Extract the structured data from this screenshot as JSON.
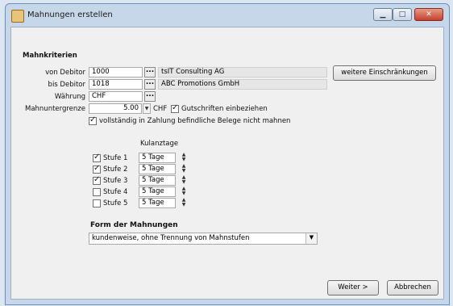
{
  "window": {
    "title": "Mahnungen erstellen"
  },
  "section_title": "Mahnkriterien",
  "fields": {
    "von_debitor": {
      "label": "von Debitor",
      "value": "1000",
      "name": "tsIT Consulting AG"
    },
    "bis_debitor": {
      "label": "bis Debitor",
      "value": "1018",
      "name": "ABC Promotions GmbH"
    },
    "waehrung": {
      "label": "Währung",
      "value": "CHF"
    },
    "mahnuntergrenze": {
      "label": "Mahnuntergrenze",
      "value": "5.00",
      "unit": "CHF"
    }
  },
  "weitere_button": {
    "label": "weitere Einschränkungen"
  },
  "checkboxes": {
    "gutschriften": {
      "label": "Gutschriften einbeziehen",
      "checked": true
    },
    "vollstaendig": {
      "label": "vollständig in Zahlung befindliche Belege nicht mahnen",
      "checked": true
    }
  },
  "kulanz_header": "Kulanztage",
  "stufen": [
    {
      "label": "Stufe 1",
      "value": "5 Tage",
      "checked": true
    },
    {
      "label": "Stufe 2",
      "value": "5 Tage",
      "checked": true
    },
    {
      "label": "Stufe 3",
      "value": "5 Tage",
      "checked": true
    },
    {
      "label": "Stufe 4",
      "value": "5 Tage",
      "checked": false
    },
    {
      "label": "Stufe 5",
      "value": "5 Tage",
      "checked": false
    }
  ],
  "form_title": "Form der Mahnungen",
  "form_select": "kundenweise, ohne Trennung von Mahnstufen",
  "buttons": {
    "weiter": "Weiter >",
    "abbrechen": "Abbrechen"
  }
}
